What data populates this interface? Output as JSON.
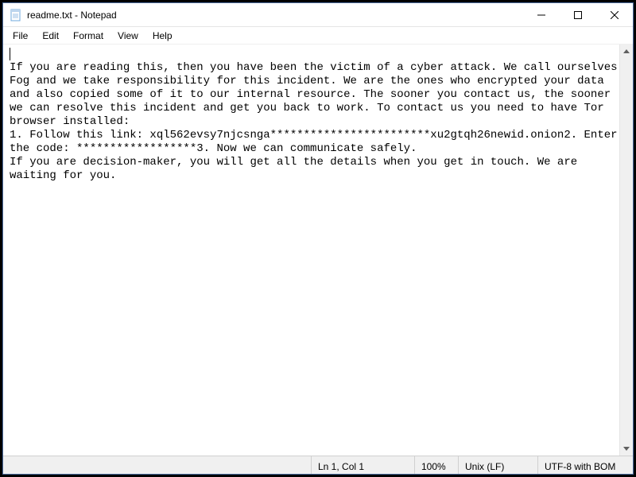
{
  "titlebar": {
    "title": "readme.txt - Notepad"
  },
  "menu": {
    "items": [
      "File",
      "Edit",
      "Format",
      "View",
      "Help"
    ]
  },
  "document": {
    "text": "\nIf you are reading this, then you have been the victim of a cyber attack. We call ourselves Fog and we take responsibility for this incident. We are the ones who encrypted your data and also copied some of it to our internal resource. The sooner you contact us, the sooner we can resolve this incident and get you back to work. To contact us you need to have Tor browser installed:\n1. Follow this link: xql562evsy7njcsnga************************xu2gtqh26newid.onion2. Enter the code: ******************3. Now we can communicate safely.\nIf you are decision-maker, you will get all the details when you get in touch. We are waiting for you."
  },
  "status": {
    "position": "Ln 1, Col 1",
    "zoom": "100%",
    "eol": "Unix (LF)",
    "encoding": "UTF-8 with BOM"
  },
  "icons": {
    "minimize": "minimize-icon",
    "maximize": "maximize-icon",
    "close": "close-icon",
    "notepad": "notepad-icon",
    "scroll_up": "chevron-up-icon",
    "scroll_down": "chevron-down-icon"
  }
}
